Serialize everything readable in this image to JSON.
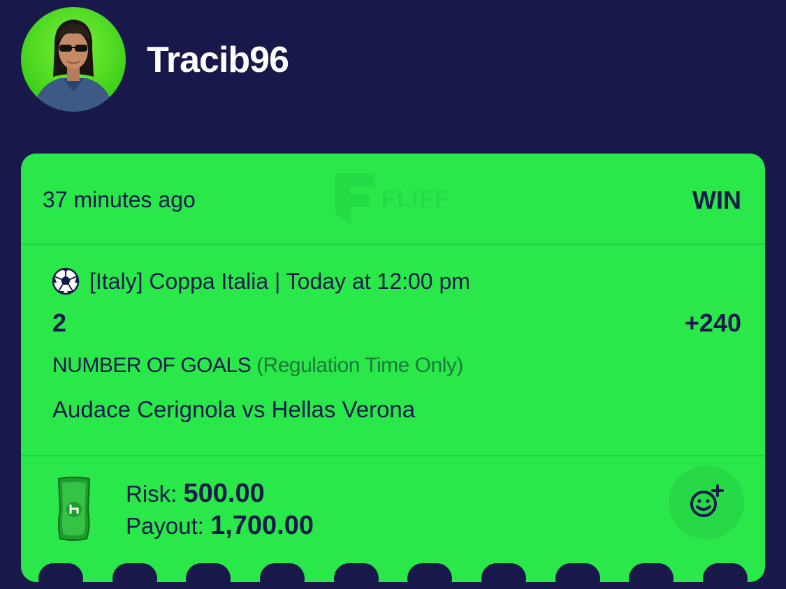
{
  "user": {
    "username": "Tracib96"
  },
  "bet": {
    "time_ago": "37 minutes ago",
    "brand": "FLIFF",
    "result": "WIN",
    "league": "[Italy] Coppa Italia | Today at 12:00 pm",
    "selection": "2",
    "odds": "+240",
    "market": "NUMBER OF GOALS",
    "market_note": "(Regulation Time Only)",
    "matchup": "Audace Cerignola vs Hellas Verona",
    "risk_label": "Risk:",
    "risk_value": "500.00",
    "payout_label": "Payout:",
    "payout_value": "1,700.00"
  },
  "colors": {
    "background": "#18184a",
    "card": "#2ae84a",
    "text": "#141a4b"
  },
  "icons": [
    "avatar",
    "soccer-ball-icon",
    "cash-icon",
    "add-reaction-icon"
  ]
}
